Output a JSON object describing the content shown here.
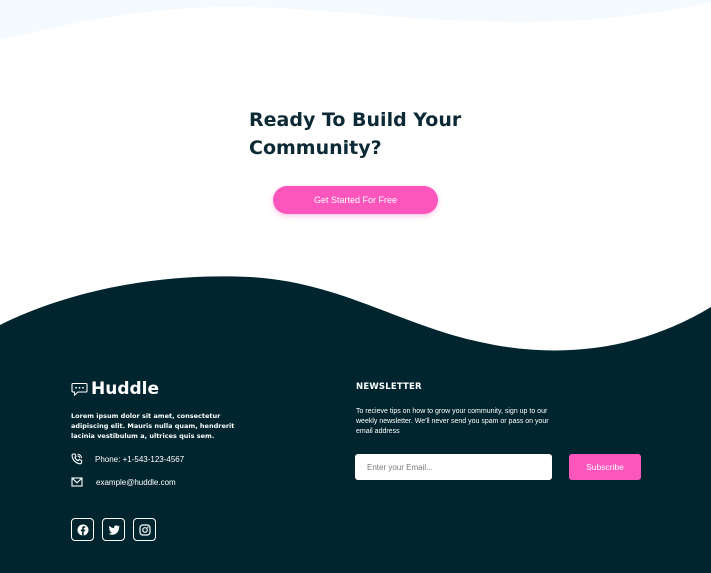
{
  "cta": {
    "heading": "Ready To Build Your Community?",
    "button_label": "Get Started For Free"
  },
  "footer": {
    "logo_text": "Huddle",
    "about": "Lorem ipsum dolor sit amet, consectetur adipiscing elit. Mauris nulla quam, hendrerit lacinia vestibulum a, ultrices quis sem.",
    "phone": "Phone: +1-543-123-4567",
    "email": "example@huddle.com",
    "social": [
      {
        "icon": "facebook-icon"
      },
      {
        "icon": "twitter-icon"
      },
      {
        "icon": "instagram-icon"
      }
    ]
  },
  "newsletter": {
    "title": "NEWSLETTER",
    "description": "To recieve tips on how to grow your community, sign up to our weekly newsletter. We'll never send you spam or pass on your email address",
    "input_placeholder": "Enter your Email...",
    "button_label": "Subscribe"
  },
  "colors": {
    "accent": "#fc55bb",
    "footer_bg": "#00252e",
    "heading": "#0c2a35",
    "top_wave": "#f5faff"
  }
}
